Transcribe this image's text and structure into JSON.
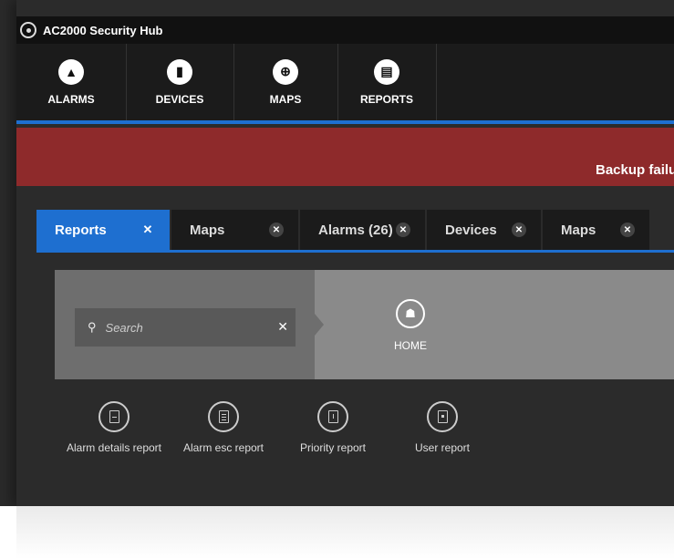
{
  "app": {
    "title": "AC2000 Security Hub"
  },
  "nav": [
    {
      "label": "ALARMS",
      "icon": "bell-icon",
      "glyph": "▲"
    },
    {
      "label": "DEVICES",
      "icon": "device-icon",
      "glyph": "▮"
    },
    {
      "label": "MAPS",
      "icon": "globe-icon",
      "glyph": "⊕"
    },
    {
      "label": "REPORTS",
      "icon": "document-icon",
      "glyph": "▤"
    }
  ],
  "alert": {
    "text": "Backup failur",
    "color": "#8e2a2b"
  },
  "accent": "#1e6fd0",
  "tabs": [
    {
      "label": "Reports",
      "active": true
    },
    {
      "label": "Maps"
    },
    {
      "label": "Alarms (26)"
    },
    {
      "label": "Devices"
    },
    {
      "label": "Maps"
    }
  ],
  "search": {
    "placeholder": "Search"
  },
  "home": {
    "label": "HOME"
  },
  "reports": [
    {
      "label": "Alarm details report"
    },
    {
      "label": "Alarm esc report"
    },
    {
      "label": "Priority report"
    },
    {
      "label": "User report"
    }
  ]
}
